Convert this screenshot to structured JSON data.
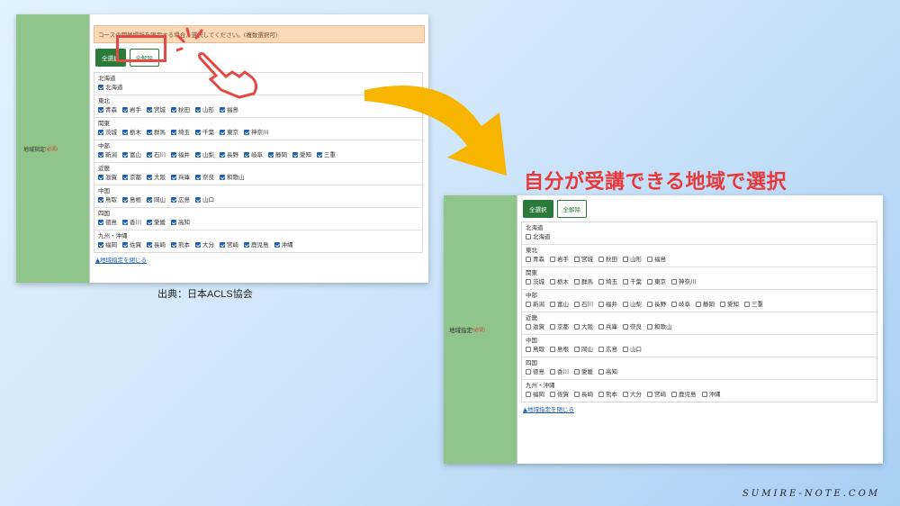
{
  "left_panel": {
    "notice": "コースの開催場所を限定する場合、選択してください。(複数選択可)",
    "label": "地域指定",
    "required": "(必須)",
    "select_all": "全選択",
    "clear_all": "全解除",
    "close_link": "▲地域指定を閉じる",
    "checked": true
  },
  "right_panel": {
    "label": "地域指定",
    "required": "(必須)",
    "select_all": "全選択",
    "clear_all": "全解除",
    "close_link": "▲地域指定を閉じる",
    "checked": false
  },
  "regions": [
    {
      "name": "北海道",
      "prefs": [
        "北海道"
      ]
    },
    {
      "name": "東北",
      "prefs": [
        "青森",
        "岩手",
        "宮城",
        "秋田",
        "山形",
        "福島"
      ]
    },
    {
      "name": "関東",
      "prefs": [
        "茨城",
        "栃木",
        "群馬",
        "埼玉",
        "千葉",
        "東京",
        "神奈川"
      ]
    },
    {
      "name": "中部",
      "prefs": [
        "新潟",
        "富山",
        "石川",
        "福井",
        "山梨",
        "長野",
        "岐阜",
        "静岡",
        "愛知",
        "三重"
      ]
    },
    {
      "name": "近畿",
      "prefs": [
        "滋賀",
        "京都",
        "大阪",
        "兵庫",
        "奈良",
        "和歌山"
      ]
    },
    {
      "name": "中国",
      "prefs": [
        "鳥取",
        "島根",
        "岡山",
        "広島",
        "山口"
      ]
    },
    {
      "name": "四国",
      "prefs": [
        "徳島",
        "香川",
        "愛媛",
        "高知"
      ]
    },
    {
      "name": "九州・沖縄",
      "prefs": [
        "福岡",
        "佐賀",
        "長崎",
        "熊本",
        "大分",
        "宮崎",
        "鹿児島",
        "沖縄"
      ]
    }
  ],
  "annotations": {
    "source": "出典：日本ACLS協会",
    "headline": "自分が受講できる地域で選択",
    "watermark": "SUMIRE-NOTE.COM",
    "highlight_color": "#e34a45",
    "arrow_color": "#f7b500"
  },
  "icons": {
    "hand": "pointing-hand-icon",
    "arrow": "curved-arrow-icon"
  }
}
